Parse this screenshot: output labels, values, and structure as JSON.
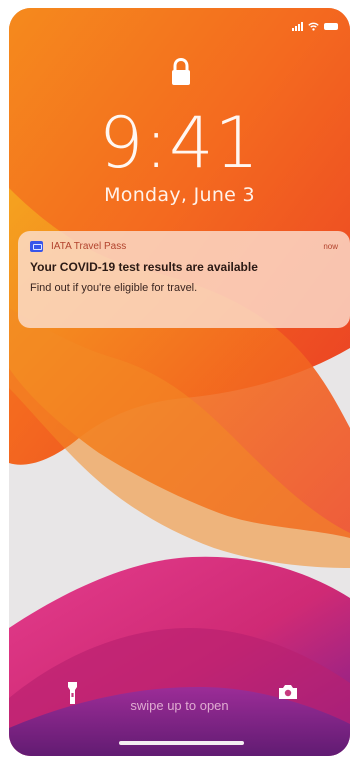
{
  "status": {
    "signal_icon": "cellular-signal-icon",
    "wifi_icon": "wifi-icon",
    "battery_icon": "battery-icon"
  },
  "lock": {
    "icon": "padlock-icon"
  },
  "clock": {
    "time": "9:41",
    "date": "Monday, June 3"
  },
  "notification": {
    "app_icon": "iata-travel-pass-app-icon",
    "app_name": "IATA Travel Pass",
    "time": "now",
    "title": "Your COVID-19 test results are available",
    "body": "Find out if you're eligible for travel."
  },
  "footer": {
    "flashlight_icon": "flashlight-icon",
    "camera_icon": "camera-icon",
    "swipe_text": "swipe up to open"
  },
  "colors": {
    "accent": "#3755ea",
    "orange": "#f06a17",
    "magenta": "#d73c7e",
    "purple": "#7d1f8d"
  }
}
